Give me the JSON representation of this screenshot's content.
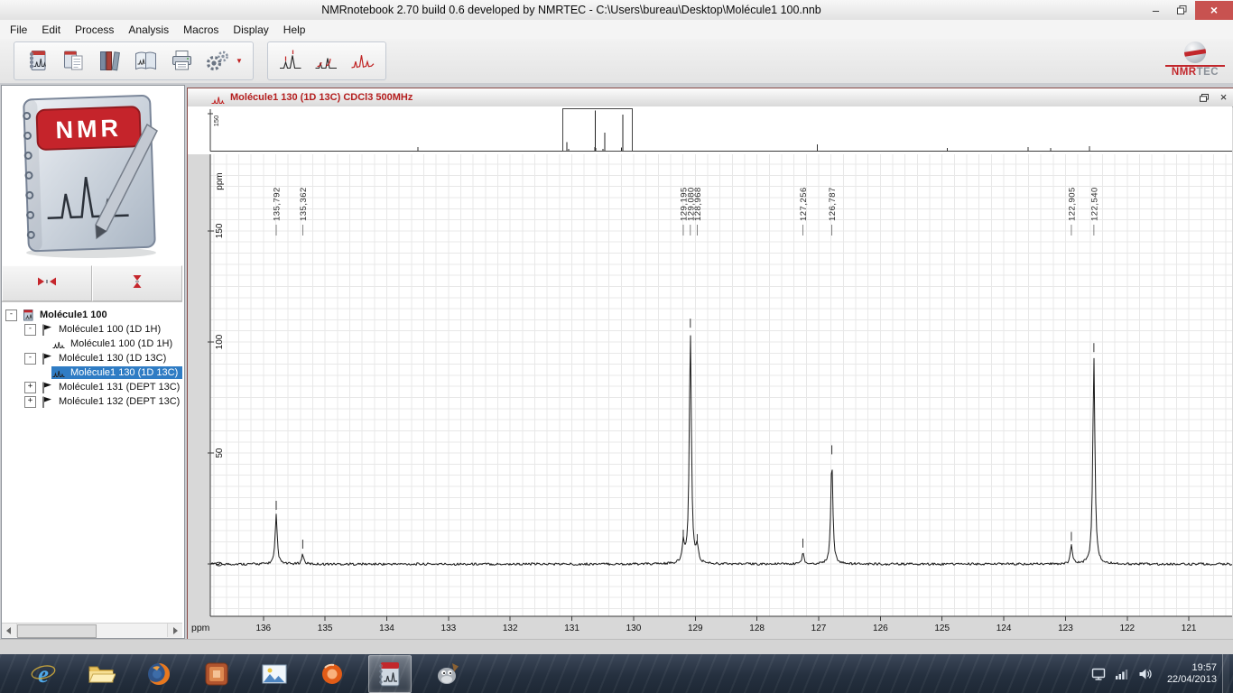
{
  "window": {
    "title": "NMRnotebook 2.70  build 0.6 developed by NMRTEC - C:\\Users\\bureau\\Desktop\\Molécule1 100.nnb",
    "minimize": "–",
    "close": "×"
  },
  "menu": [
    "File",
    "Edit",
    "Process",
    "Analysis",
    "Macros",
    "Display",
    "Help"
  ],
  "toolbar": {
    "group1": [
      "notebook-icon",
      "notebook-page-icon",
      "library-icon",
      "book-spectrum-icon",
      "printer-icon"
    ],
    "gears": {
      "icon": "gears-icon",
      "dropdown": "▼"
    },
    "group2": [
      "peak-pick-icon",
      "integrals-icon",
      "spectrum-icon"
    ],
    "logo": {
      "nmr": "NMR",
      "tec": "TEC"
    }
  },
  "sidebar": {
    "logo_label": "NMR",
    "collapse_buttons": [
      "collapse-horizontal-icon",
      "collapse-vertical-icon"
    ],
    "tree": [
      {
        "label": "Molécule1 100",
        "level": 0,
        "expander": "-",
        "icon": "notebook",
        "bold": true
      },
      {
        "label": "Molécule1 100 (1D 1H)",
        "level": 1,
        "expander": "-",
        "icon": "flag"
      },
      {
        "label": "Molécule1 100 (1D 1H)",
        "level": 2,
        "expander": "",
        "icon": "spectrum"
      },
      {
        "label": "Molécule1 130 (1D 13C)",
        "level": 1,
        "expander": "-",
        "icon": "flag"
      },
      {
        "label": "Molécule1 130 (1D 13C)",
        "level": 2,
        "expander": "",
        "icon": "spectrum",
        "selected": true
      },
      {
        "label": "Molécule1 131 (DEPT 13C)",
        "level": 1,
        "expander": "+",
        "icon": "flag"
      },
      {
        "label": "Molécule1 132 (DEPT 13C)",
        "level": 1,
        "expander": "+",
        "icon": "flag"
      }
    ]
  },
  "document": {
    "title": "Molécule1 130 (1D 13C) CDCl3 500MHz",
    "close": "×"
  },
  "chart_data": {
    "type": "line",
    "title": "Molécule1 130 (1D 13C) CDCl3 500MHz",
    "xlabel": "ppm",
    "ylabel": "ppm",
    "x_range": [
      136.86,
      120.3
    ],
    "x_ticks": [
      136,
      135,
      134,
      133,
      132,
      131,
      130,
      129,
      128,
      127,
      126,
      125,
      124,
      123,
      122,
      121
    ],
    "y_range": [
      -23.5,
      184.5
    ],
    "y_ticks": [
      0,
      50,
      100,
      150
    ],
    "grid": {
      "x_step": 0.2,
      "y_step": 5
    },
    "axis_label_top": "ppm",
    "peaks": [
      {
        "ppm": 135.792,
        "height": 22,
        "label": "135,792"
      },
      {
        "ppm": 135.362,
        "height": 4.5,
        "label": "135,362"
      },
      {
        "ppm": 129.195,
        "height": 9,
        "label": "129,195"
      },
      {
        "ppm": 129.08,
        "height": 104,
        "label": "129,080"
      },
      {
        "ppm": 128.968,
        "height": 7,
        "label": "128,968"
      },
      {
        "ppm": 127.256,
        "height": 5,
        "label": "127,256"
      },
      {
        "ppm": 126.787,
        "height": 47,
        "label": "126,787"
      },
      {
        "ppm": 122.905,
        "height": 8,
        "label": "122,905"
      },
      {
        "ppm": 122.54,
        "height": 93,
        "label": "122,540"
      }
    ],
    "overview": {
      "axis_label": "150",
      "full_x_range": [
        220.6,
        -22.3
      ],
      "minor_marks": [
        {
          "ppm": 171.3,
          "height": 4
        },
        {
          "ppm": 76.3,
          "height": 7
        },
        {
          "ppm": 45.4,
          "height": 3
        },
        {
          "ppm": 26.2,
          "height": 4
        },
        {
          "ppm": 20.8,
          "height": 3
        },
        {
          "ppm": 11.6,
          "height": 5
        }
      ]
    }
  },
  "taskbar": {
    "apps": [
      {
        "name": "internet-explorer"
      },
      {
        "name": "file-explorer"
      },
      {
        "name": "firefox"
      },
      {
        "name": "media-app"
      },
      {
        "name": "photo-viewer"
      },
      {
        "name": "browser-orange"
      },
      {
        "name": "nmrnotebook",
        "active": true
      },
      {
        "name": "gimp"
      }
    ],
    "tray_icons": [
      "display-icon",
      "network-icon",
      "volume-icon"
    ],
    "clock": {
      "time": "19:57",
      "date": "22/04/2013"
    }
  }
}
